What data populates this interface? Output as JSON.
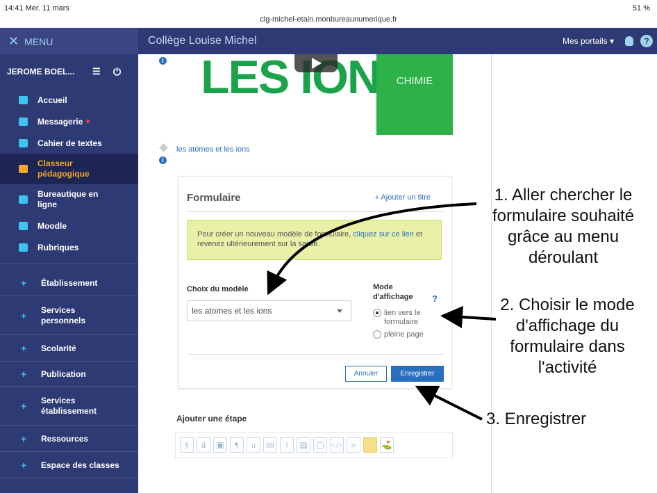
{
  "statusbar": {
    "time": "14:41  Mer. 11 mars",
    "url": "clg-michel-etain.monbureaunumerique.fr",
    "battery": "51 %"
  },
  "topbar": {
    "menu_label": "MENU",
    "school": "Collège Louise Michel",
    "portals": "Mes portails ▾"
  },
  "sidebar": {
    "user": "JEROME BOEL...",
    "items": [
      {
        "label": "Accueil"
      },
      {
        "label": "Messagerie"
      },
      {
        "label": "Cahier de textes"
      },
      {
        "label": "Classeur pédagogique"
      },
      {
        "label": "Bureautique en ligne"
      },
      {
        "label": "Moodle"
      },
      {
        "label": "Rubriques"
      }
    ],
    "sections": [
      {
        "label": "Établissement"
      },
      {
        "label": "Services personnels"
      },
      {
        "label": "Scolarité"
      },
      {
        "label": "Publication"
      },
      {
        "label": "Services établissement"
      },
      {
        "label": "Ressources"
      },
      {
        "label": "Espace des classes"
      }
    ]
  },
  "video": {
    "title": "LES IONS",
    "subject": "CHIMIE"
  },
  "activity_link": "les atomes et les ions",
  "form": {
    "title": "Formulaire",
    "add_title": "+ Ajouter un titre",
    "notice_pre": "Pour créer un nouveau modèle de formulaire, ",
    "notice_link": "cliquez sur ce lien",
    "notice_post": " et revenez ultérieurement sur la saisie.",
    "choice_label": "Choix du modèle",
    "selected_model": "les atomes et les ions",
    "mode_label": "Mode d'affichage",
    "mode_help": "?",
    "option_link": "lien vers le formulaire",
    "option_full": "pleine page",
    "cancel": "Annuler",
    "save": "Enregistrer"
  },
  "add_step": {
    "label": "Ajouter une étape",
    "buttons": [
      "§",
      "a",
      "▣",
      "¶",
      "π",
      "99",
      "⍿",
      "▤",
      "▢",
      "</>",
      "∞",
      " ",
      "⛳"
    ]
  },
  "annotations": {
    "step1": "1. Aller chercher le formulaire souhaité grâce au menu déroulant",
    "step2": "2. Choisir le mode d'affichage du formulaire dans l'activité",
    "step3": "3. Enregistrer"
  }
}
